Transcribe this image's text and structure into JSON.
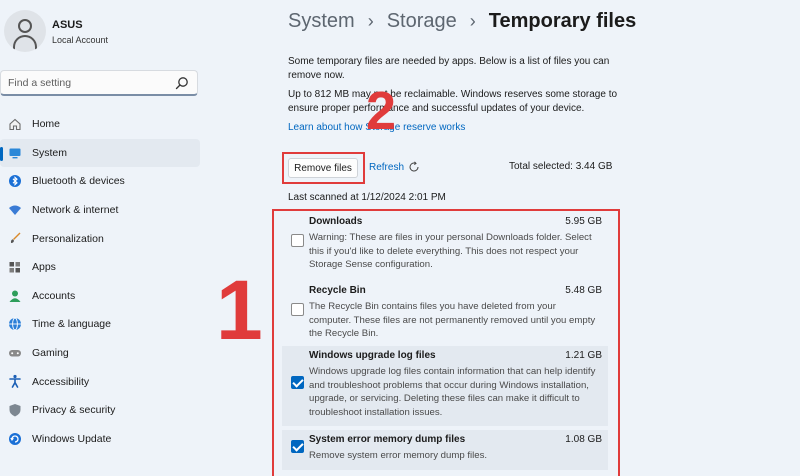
{
  "profile": {
    "name": "ASUS",
    "subtitle": "Local Account"
  },
  "search": {
    "placeholder": "Find a setting"
  },
  "sidebar": {
    "items": [
      {
        "label": "Home",
        "icon": "home-icon",
        "active": false
      },
      {
        "label": "System",
        "icon": "system-icon",
        "active": true
      },
      {
        "label": "Bluetooth & devices",
        "icon": "bluetooth-icon",
        "active": false
      },
      {
        "label": "Network & internet",
        "icon": "network-icon",
        "active": false
      },
      {
        "label": "Personalization",
        "icon": "personalization-icon",
        "active": false
      },
      {
        "label": "Apps",
        "icon": "apps-icon",
        "active": false
      },
      {
        "label": "Accounts",
        "icon": "accounts-icon",
        "active": false
      },
      {
        "label": "Time & language",
        "icon": "time-language-icon",
        "active": false
      },
      {
        "label": "Gaming",
        "icon": "gaming-icon",
        "active": false
      },
      {
        "label": "Accessibility",
        "icon": "accessibility-icon",
        "active": false
      },
      {
        "label": "Privacy & security",
        "icon": "privacy-icon",
        "active": false
      },
      {
        "label": "Windows Update",
        "icon": "windows-update-icon",
        "active": false
      }
    ]
  },
  "breadcrumb": {
    "part1": "System",
    "part2": "Storage",
    "current": "Temporary files",
    "separator": "›"
  },
  "main": {
    "desc1": "Some temporary files are needed by apps. Below is a list of files you can remove now.",
    "desc2": "Up to 812 MB may not be reclaimable. Windows reserves some storage to ensure proper performance and successful updates of your device.",
    "learn_link": "Learn about how Storage reserve works",
    "remove_button": "Remove files",
    "refresh_label": "Refresh",
    "total_selected": "Total selected: 3.44 GB",
    "last_scanned": "Last scanned at 1/12/2024 2:01 PM"
  },
  "files": [
    {
      "name": "Downloads",
      "size": "5.95 GB",
      "checked": false,
      "desc": "Warning: These are files in your personal Downloads folder. Select this if you'd like to delete everything. This does not respect your Storage Sense configuration."
    },
    {
      "name": "Recycle Bin",
      "size": "5.48 GB",
      "checked": false,
      "desc": "The Recycle Bin contains files you have deleted from your computer. These files are not permanently removed until you empty the Recycle Bin."
    },
    {
      "name": "Windows upgrade log files",
      "size": "1.21 GB",
      "checked": true,
      "desc": "Windows upgrade log files contain information that can help identify and troubleshoot problems that occur during Windows installation, upgrade, or servicing.  Deleting these files can make it difficult to troubleshoot installation issues."
    },
    {
      "name": "System error memory dump files",
      "size": "1.08 GB",
      "checked": true,
      "desc": "Remove system error memory dump files."
    }
  ],
  "annotations": {
    "marker1": "1",
    "marker2": "2"
  },
  "colors": {
    "accent": "#0067c0",
    "highlight": "#e03b3b",
    "background": "#eef3f9"
  }
}
